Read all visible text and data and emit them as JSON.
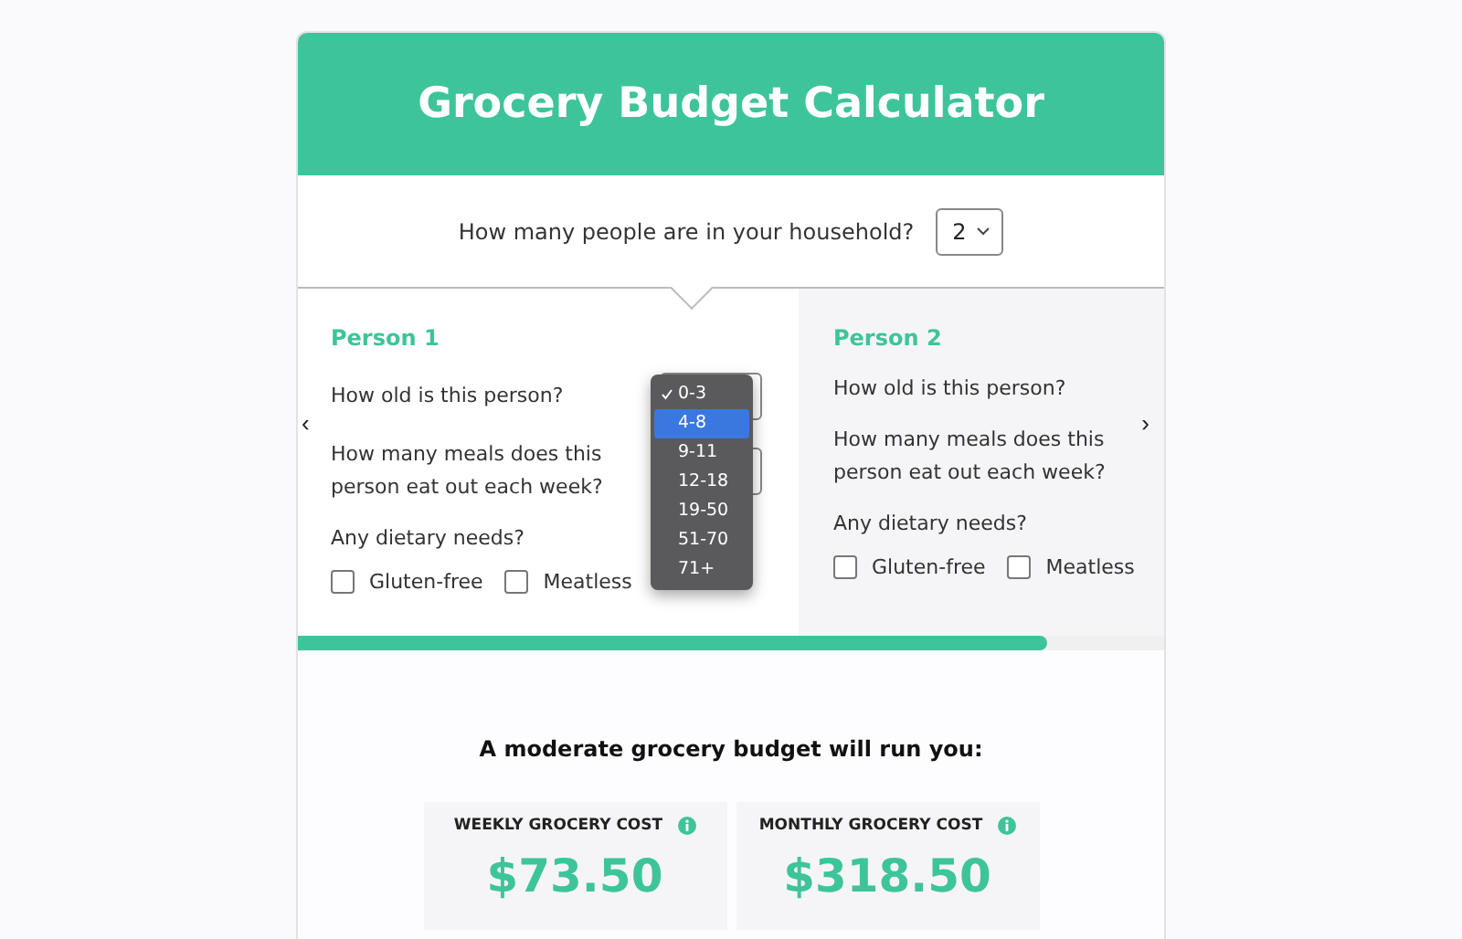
{
  "header": {
    "title": "Grocery Budget Calculator"
  },
  "household": {
    "question": "How many people are in your household?",
    "value": "2"
  },
  "carousel": {
    "prev": "‹",
    "next": "›",
    "level": 0.865
  },
  "people": [
    {
      "title": "Person 1",
      "age_question": "How old is this person?",
      "meals_question": "How many meals does this person eat out each week?",
      "diet_question": "Any dietary needs?",
      "options": [
        {
          "label": "Gluten-free",
          "checked": false
        },
        {
          "label": "Meatless",
          "checked": false
        }
      ]
    },
    {
      "title": "Person 2",
      "age_question": "How old is this person?",
      "meals_question": "How many meals does this person eat out each week?",
      "diet_question": "Any dietary needs?",
      "options": [
        {
          "label": "Gluten-free",
          "checked": false
        },
        {
          "label": "Meatless",
          "checked": false
        }
      ]
    }
  ],
  "age_menu": {
    "options": [
      {
        "label": "0-3",
        "selected": true,
        "highlighted": false
      },
      {
        "label": "4-8",
        "selected": false,
        "highlighted": true
      },
      {
        "label": "9-11",
        "selected": false,
        "highlighted": false
      },
      {
        "label": "12-18",
        "selected": false,
        "highlighted": false
      },
      {
        "label": "19-50",
        "selected": false,
        "highlighted": false
      },
      {
        "label": "51-70",
        "selected": false,
        "highlighted": false
      },
      {
        "label": "71+",
        "selected": false,
        "highlighted": false
      }
    ]
  },
  "results": {
    "heading": "A moderate grocery budget will run you:",
    "cards": [
      {
        "label": "WEEKLY GROCERY COST",
        "value": "$73.50"
      },
      {
        "label": "MONTHLY GROCERY COST",
        "value": "$318.50"
      }
    ]
  }
}
